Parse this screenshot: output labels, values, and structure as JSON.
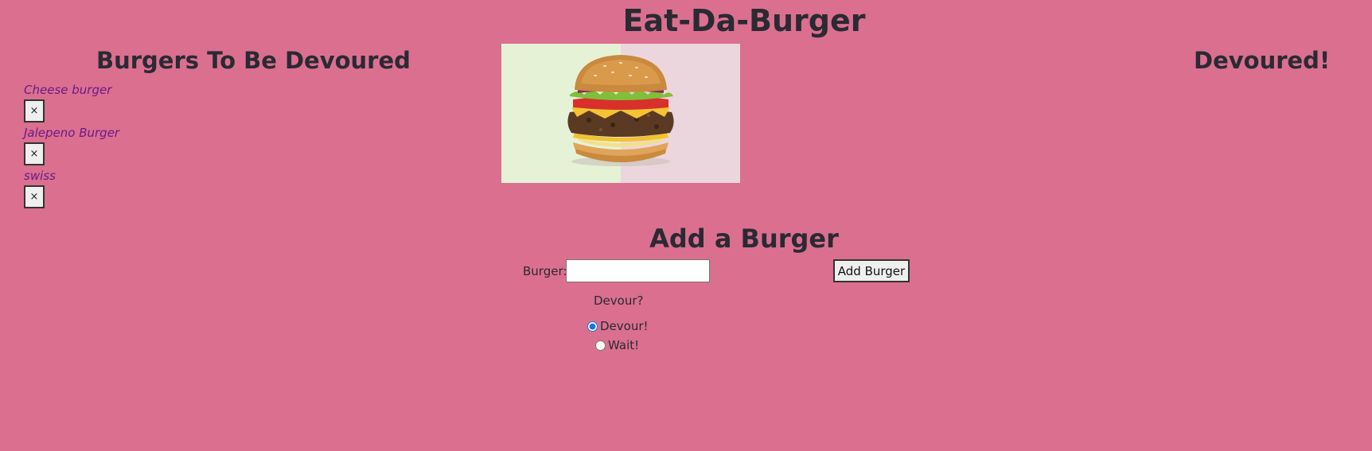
{
  "header": {
    "title": "Eat-Da-Burger"
  },
  "columns": {
    "left_heading": "Burgers To Be Devoured",
    "right_heading": "Devoured!"
  },
  "burgers_to_devour": [
    {
      "name": "Cheese burger",
      "button_label": "×"
    },
    {
      "name": "Jalepeno Burger",
      "button_label": "×"
    },
    {
      "name": "swiss",
      "button_label": "×"
    }
  ],
  "form": {
    "heading": "Add a Burger",
    "burger_label": "Burger:",
    "burger_value": "",
    "submit_label": "Add Burger",
    "devour_question": "Devour?",
    "options": [
      {
        "label": "Devour!",
        "checked": true
      },
      {
        "label": "Wait!",
        "checked": false
      }
    ]
  },
  "colors": {
    "background": "#db6f8f",
    "burger_text": "#6a1a8a",
    "image_left_bg": "#e6f2d6",
    "image_right_bg": "#ecd6de"
  },
  "image": {
    "subject": "burger-photo"
  }
}
